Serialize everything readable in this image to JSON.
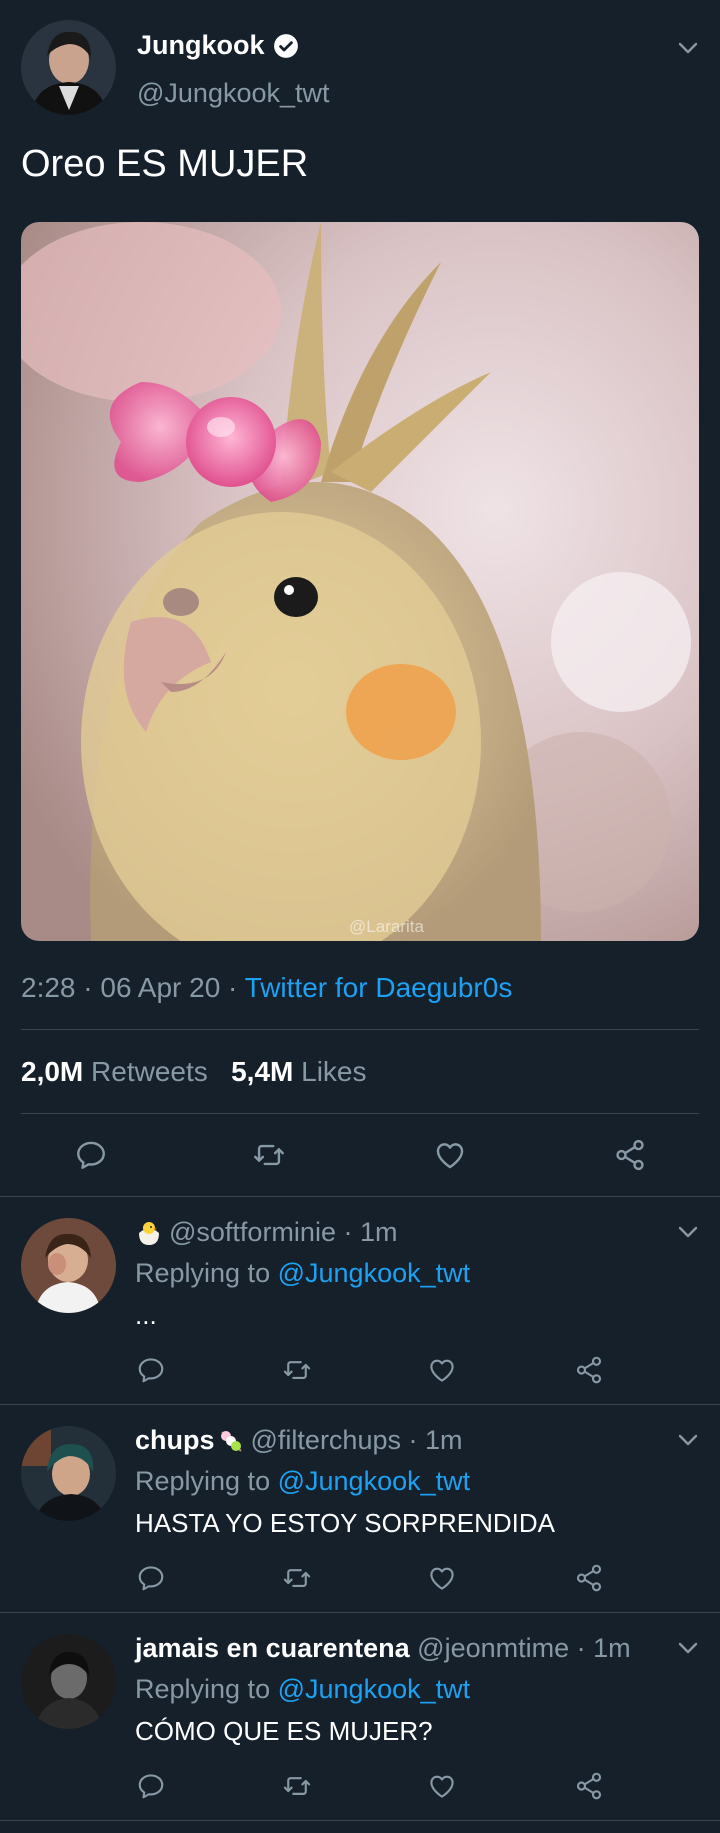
{
  "tweet": {
    "display_name": "Jungkook",
    "handle": "@Jungkook_twt",
    "text": "Oreo ES MUJER",
    "photo_watermark": "@Lararita",
    "time": "2:28",
    "date": "06 Apr 20",
    "source": "Twitter for Daegubr0s",
    "retweets_count": "2,0M",
    "retweets_label": "Retweets",
    "likes_count": "5,4M",
    "likes_label": "Likes"
  },
  "replies": [
    {
      "display_name": "",
      "handle": "@softforminie",
      "time": "1m",
      "replying_label": "Replying to",
      "replying_to": "@Jungkook_twt",
      "text": "..."
    },
    {
      "display_name": "chups",
      "handle": "@filterchups",
      "time": "1m",
      "replying_label": "Replying to",
      "replying_to": "@Jungkook_twt",
      "text": "HASTA YO ESTOY SORPRENDIDA"
    },
    {
      "display_name": "jamais en cuarentena",
      "handle": "@jeonmtime",
      "time": "1m",
      "replying_label": "Replying to",
      "replying_to": "@Jungkook_twt",
      "text": "CÓMO QUE ES MUJER?"
    }
  ],
  "icons": [
    "verified-icon",
    "chevron-down-icon",
    "reply-icon",
    "retweet-icon",
    "like-icon",
    "share-icon",
    "chick-emoji-icon",
    "dango-emoji-icon"
  ],
  "colors": {
    "background": "#15202b",
    "accent": "#1da1f2",
    "muted": "#8899a6",
    "divider": "#38444d"
  }
}
